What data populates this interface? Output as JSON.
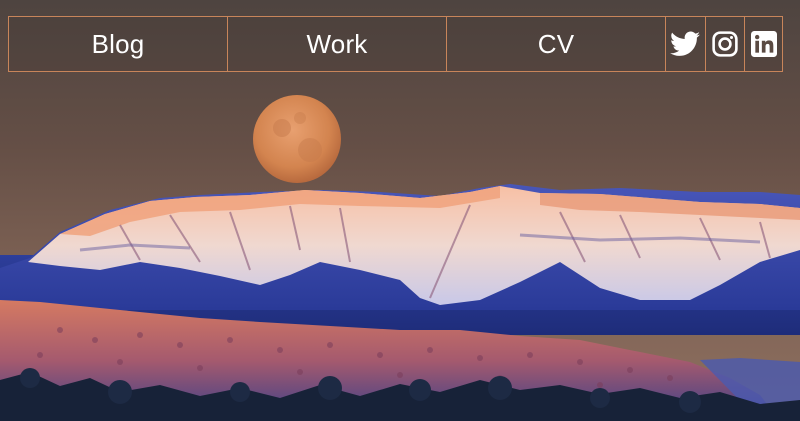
{
  "nav": {
    "links": [
      {
        "label": "Blog"
      },
      {
        "label": "Work"
      },
      {
        "label": "CV"
      }
    ],
    "social": [
      {
        "icon": "twitter-icon"
      },
      {
        "icon": "instagram-icon"
      },
      {
        "icon": "linkedin-icon"
      }
    ]
  },
  "hero": {
    "description_icon": "landscape-photo",
    "colors": {
      "sky_top": "#5a4a42",
      "sky_mid": "#6a5147",
      "sky_horizon": "#8a6a5a",
      "moon": "#d88a5a",
      "snow": "#f2c8b8",
      "mountain_shadow": "#3a4aa8",
      "hills": "#c86a58",
      "foreground": "#1a2a40",
      "nav_border": "#c8855a"
    }
  }
}
